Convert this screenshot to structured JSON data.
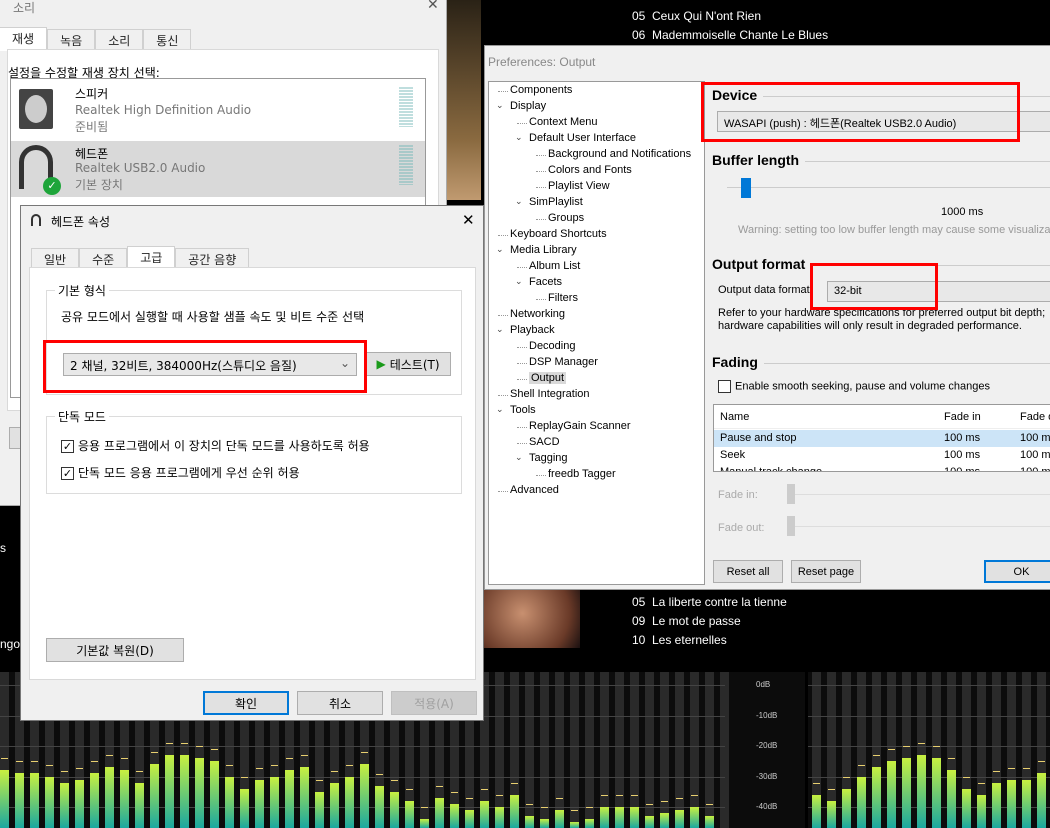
{
  "sound_window": {
    "title": "소리",
    "tabs": [
      "재생",
      "녹음",
      "소리",
      "통신"
    ],
    "instruction": "설정을 수정할 재생 장치 선택:",
    "devices": [
      {
        "name": "스피커",
        "driver": "Realtek High Definition Audio",
        "status": "준비됨",
        "icon": "speaker-icon"
      },
      {
        "name": "헤드폰",
        "driver": "Realtek USB2.0 Audio",
        "status": "기본 장치",
        "icon": "headphones-icon",
        "default": true
      }
    ]
  },
  "props_dialog": {
    "title": "헤드폰 속성",
    "tabs": [
      "일반",
      "수준",
      "고급",
      "공간 음향"
    ],
    "active_tab": "고급",
    "default_format": {
      "label": "기본 형식",
      "description": "공유 모드에서 실행할 때 사용할 샘플 속도 및 비트 수준 선택",
      "selected": "2 채널, 32비트, 384000Hz(스튜디오 음질)",
      "test_button": "테스트(T)"
    },
    "exclusive": {
      "label": "단독 모드",
      "options": [
        {
          "label": "응용 프로그램에서 이 장치의 단독 모드를 사용하도록 허용",
          "checked": true
        },
        {
          "label": "단독 모드 응용 프로그램에게 우선 순위 허용",
          "checked": true
        }
      ]
    },
    "restore_button": "기본값 복원(D)",
    "ok": "확인",
    "cancel": "취소",
    "apply": "적용(A)"
  },
  "preferences": {
    "title": "Preferences: Output",
    "tree": [
      {
        "label": "Components",
        "level": 0
      },
      {
        "label": "Display",
        "level": 0,
        "expanded": true
      },
      {
        "label": "Context Menu",
        "level": 1
      },
      {
        "label": "Default User Interface",
        "level": 1,
        "expanded": true
      },
      {
        "label": "Background and Notifications",
        "level": 2
      },
      {
        "label": "Colors and Fonts",
        "level": 2
      },
      {
        "label": "Playlist View",
        "level": 2
      },
      {
        "label": "SimPlaylist",
        "level": 1,
        "expanded": true
      },
      {
        "label": "Groups",
        "level": 2
      },
      {
        "label": "Keyboard Shortcuts",
        "level": 0
      },
      {
        "label": "Media Library",
        "level": 0,
        "expanded": true
      },
      {
        "label": "Album List",
        "level": 1
      },
      {
        "label": "Facets",
        "level": 1,
        "expanded": true
      },
      {
        "label": "Filters",
        "level": 2
      },
      {
        "label": "Networking",
        "level": 0
      },
      {
        "label": "Playback",
        "level": 0,
        "expanded": true
      },
      {
        "label": "Decoding",
        "level": 1
      },
      {
        "label": "DSP Manager",
        "level": 1
      },
      {
        "label": "Output",
        "level": 1,
        "selected": true
      },
      {
        "label": "Shell Integration",
        "level": 0
      },
      {
        "label": "Tools",
        "level": 0,
        "expanded": true
      },
      {
        "label": "ReplayGain Scanner",
        "level": 1
      },
      {
        "label": "SACD",
        "level": 1
      },
      {
        "label": "Tagging",
        "level": 1,
        "expanded": true
      },
      {
        "label": "freedb Tagger",
        "level": 2
      },
      {
        "label": "Advanced",
        "level": 0
      }
    ],
    "device": {
      "heading": "Device",
      "value": "WASAPI (push) : 헤드폰(Realtek USB2.0 Audio)"
    },
    "buffer": {
      "heading": "Buffer length",
      "value": "1000 ms",
      "slider_fraction": 0.02,
      "warning": "Warning: setting too low buffer length may cause some visualizat"
    },
    "output_format": {
      "heading": "Output format",
      "label": "Output data format",
      "value": "32-bit",
      "note_line1": "Refer to your hardware specifications for preferred output bit depth;",
      "note_line2": "hardware capabilities will only result in degraded performance."
    },
    "fading": {
      "heading": "Fading",
      "checkbox": "Enable smooth seeking, pause and volume changes",
      "columns": [
        "Name",
        "Fade in",
        "Fade o"
      ],
      "rows": [
        [
          "Pause and stop",
          "100 ms",
          "100 ms"
        ],
        [
          "Seek",
          "100 ms",
          "100 ms"
        ],
        [
          "Manual track change",
          "100 ms",
          "100 ms"
        ]
      ],
      "fade_in_label": "Fade in:",
      "fade_out_label": "Fade out:"
    },
    "reset_all": "Reset all",
    "reset_page": "Reset page",
    "ok": "OK"
  },
  "player": {
    "tracks_top": [
      {
        "no": "05",
        "title": "Ceux Qui N'ont Rien"
      },
      {
        "no": "06",
        "title": "Mademmoiselle Chante Le Blues"
      }
    ],
    "tracks_bottom": [
      {
        "no": "05",
        "title": "La liberte contre la tienne"
      },
      {
        "no": "09",
        "title": "Le mot de passe"
      },
      {
        "no": "10",
        "title": "Les eternelles"
      }
    ],
    "left_fragments": [
      "s",
      "ngo"
    ],
    "spectrum": {
      "db_labels": [
        "0dB",
        "-10dB",
        "-20dB",
        "-30dB",
        "-40dB"
      ],
      "left_levels": [
        -28,
        -29,
        -29,
        -30,
        -32,
        -31,
        -29,
        -27,
        -28,
        -32,
        -26,
        -23,
        -23,
        -24,
        -25,
        -30,
        -34,
        -31,
        -30,
        -28,
        -27,
        -35,
        -32,
        -30,
        -26,
        -33,
        -35,
        -38,
        -44,
        -37,
        -39,
        -41,
        -38,
        -40,
        -36,
        -43,
        -44,
        -41,
        -45,
        -44,
        -40,
        -40,
        -40,
        -43,
        -42,
        -41,
        -40,
        -43
      ],
      "right_levels": [
        -36,
        -38,
        -34,
        -30,
        -27,
        -25,
        -24,
        -23,
        -24,
        -28,
        -34,
        -36,
        -32,
        -31,
        -31,
        -29
      ]
    },
    "colors": {
      "bar_top": "#c8f040",
      "bar_bottom": "#1aa8a0",
      "column_bg": "#2a2a2a",
      "highlight": "#ff0000"
    }
  }
}
